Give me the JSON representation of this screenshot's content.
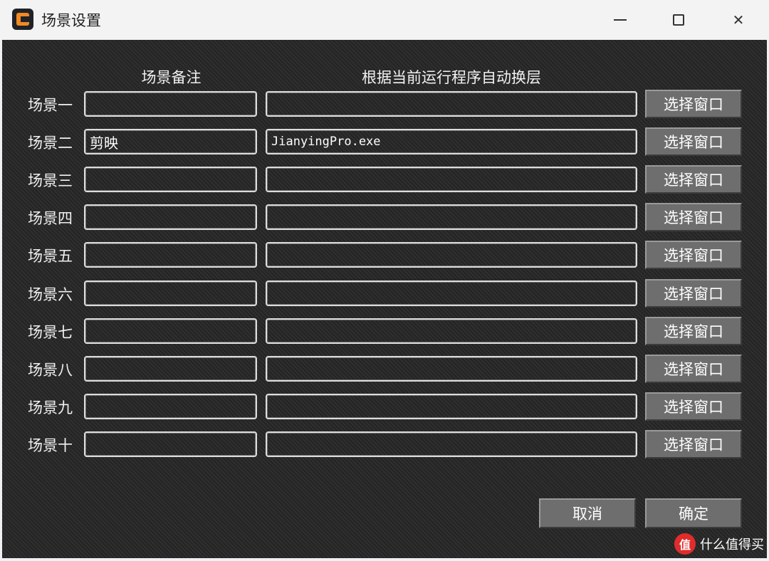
{
  "window": {
    "title": "场景设置"
  },
  "headers": {
    "note": "场景备注",
    "auto_switch": "根据当前运行程序自动换层"
  },
  "rows": [
    {
      "label": "场景一",
      "note": "",
      "process": "",
      "button": "选择窗口"
    },
    {
      "label": "场景二",
      "note": "剪映",
      "process": "JianyingPro.exe",
      "button": "选择窗口"
    },
    {
      "label": "场景三",
      "note": "",
      "process": "",
      "button": "选择窗口"
    },
    {
      "label": "场景四",
      "note": "",
      "process": "",
      "button": "选择窗口"
    },
    {
      "label": "场景五",
      "note": "",
      "process": "",
      "button": "选择窗口"
    },
    {
      "label": "场景六",
      "note": "",
      "process": "",
      "button": "选择窗口"
    },
    {
      "label": "场景七",
      "note": "",
      "process": "",
      "button": "选择窗口"
    },
    {
      "label": "场景八",
      "note": "",
      "process": "",
      "button": "选择窗口"
    },
    {
      "label": "场景九",
      "note": "",
      "process": "",
      "button": "选择窗口"
    },
    {
      "label": "场景十",
      "note": "",
      "process": "",
      "button": "选择窗口"
    }
  ],
  "footer": {
    "cancel_label": "取消",
    "ok_label": "确定"
  },
  "watermark": {
    "text": "什么值得买",
    "icon_glyph": "值"
  }
}
